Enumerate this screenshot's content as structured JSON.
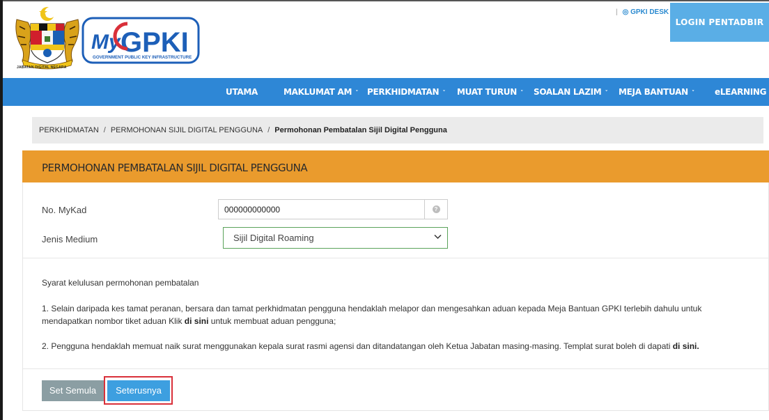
{
  "header": {
    "coat_caption": "JABATAN DIGITAL NEGARA",
    "logo_main": "MyGPKI",
    "logo_sub": "GOVERNMENT PUBLIC KEY INFRASTRUCTURE",
    "gpki_desk": "GPKI DESK",
    "login_label": "LOGIN PENTADBIR"
  },
  "nav": {
    "items": [
      {
        "label": "UTAMA",
        "has_dropdown": false
      },
      {
        "label": "MAKLUMAT AM",
        "has_dropdown": true
      },
      {
        "label": "PERKHIDMATAN",
        "has_dropdown": true
      },
      {
        "label": "MUAT TURUN",
        "has_dropdown": true
      },
      {
        "label": "SOALAN LAZIM",
        "has_dropdown": true
      },
      {
        "label": "MEJA BANTUAN",
        "has_dropdown": true
      },
      {
        "label": "eLEARNING",
        "has_dropdown": false
      }
    ],
    "chevron": "˅"
  },
  "breadcrumb": {
    "items": [
      "PERKHIDMATAN",
      "PERMOHONAN SIJIL DIGITAL PENGGUNA"
    ],
    "current": "Permohonan Pembatalan Sijil Digital Pengguna",
    "separator": "/"
  },
  "panel": {
    "title": "PERMOHONAN PEMBATALAN SIJIL DIGITAL PENGGUNA"
  },
  "form": {
    "mykad_label": "No. MyKad",
    "mykad_value": "000000000000",
    "medium_label": "Jenis Medium",
    "medium_value": "Sijil Digital Roaming"
  },
  "terms": {
    "heading": "Syarat kelulusan permohonan pembatalan",
    "item1_line1": "1. Selain daripada kes tamat peranan, bersara dan tamat perkhidmatan pengguna hendaklah melapor dan mengesahkan aduan kepada Meja Bantuan GPKI terlebih dahulu untuk",
    "item1_line2_pre": "mendapatkan nombor tiket aduan Klik ",
    "item1_link": "di sini",
    "item1_line2_post": " untuk membuat aduan pengguna;",
    "item2_pre": "2. Pengguna hendaklah memuat naik surat menggunakan kepala surat rasmi agensi dan ditandatangan oleh Ketua Jabatan masing-masing. Templat surat boleh di dapati ",
    "item2_link": "di sini."
  },
  "buttons": {
    "reset": "Set Semula",
    "next": "Seterusnya"
  },
  "colors": {
    "nav": "#2e87d6",
    "login": "#5aaee6",
    "panel_header": "#ea9b2d",
    "next_button": "#3d9fe0",
    "reset_button": "#8b9ea3",
    "highlight": "#d9303a"
  }
}
